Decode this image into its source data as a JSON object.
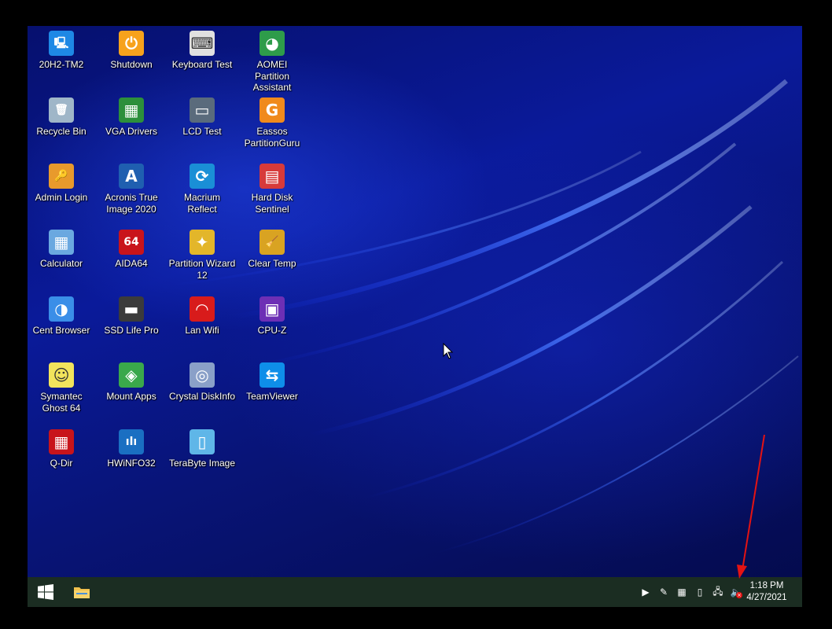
{
  "desktop": {
    "icons": [
      {
        "label": "20H2-TM2",
        "glyph": "🖳",
        "bg": "#1e88e5",
        "color": "#ffffff"
      },
      {
        "label": "Shutdown",
        "glyph": "⏻",
        "bg": "#f7a21c",
        "color": "#ffffff"
      },
      {
        "label": "Keyboard Test",
        "glyph": "⌨",
        "bg": "#e0e0e0",
        "color": "#333333"
      },
      {
        "label": "AOMEI Partition Assistant",
        "glyph": "◕",
        "bg": "#2e9c4a",
        "color": "#ffffff"
      },
      {
        "label": "Recycle Bin",
        "glyph": "🗑",
        "bg": "#9fb6c8",
        "color": "#ffffff"
      },
      {
        "label": "VGA Drivers",
        "glyph": "▦",
        "bg": "#2c8f3b",
        "color": "#ffffff"
      },
      {
        "label": "LCD Test",
        "glyph": "▭",
        "bg": "#5a6b7c",
        "color": "#ffffff"
      },
      {
        "label": "Eassos PartitionGuru",
        "glyph": "G",
        "bg": "#f08a1c",
        "color": "#ffffff"
      },
      {
        "label": "Admin Login",
        "glyph": "🔑",
        "bg": "#e89a2c",
        "color": "#ffffff"
      },
      {
        "label": "Acronis True Image 2020",
        "glyph": "A",
        "bg": "#1f5fb0",
        "color": "#ffffff"
      },
      {
        "label": "Macrium Reflect",
        "glyph": "⟳",
        "bg": "#1a8fd6",
        "color": "#ffffff"
      },
      {
        "label": "Hard Disk Sentinel",
        "glyph": "▤",
        "bg": "#d73a3a",
        "color": "#ffffff"
      },
      {
        "label": "Calculator",
        "glyph": "▦",
        "bg": "#6aa8e0",
        "color": "#ffffff"
      },
      {
        "label": "AIDA64",
        "glyph": "64",
        "bg": "#c9141b",
        "color": "#ffffff"
      },
      {
        "label": "Partition Wizard 12",
        "glyph": "✦",
        "bg": "#e3b62a",
        "color": "#ffffff"
      },
      {
        "label": "Clear Temp",
        "glyph": "🧹",
        "bg": "#d9a322",
        "color": "#ffffff"
      },
      {
        "label": "Cent Browser",
        "glyph": "◑",
        "bg": "#3a8ee8",
        "color": "#ffffff"
      },
      {
        "label": "SSD Life Pro",
        "glyph": "▬",
        "bg": "#3b3b3b",
        "color": "#ffffff"
      },
      {
        "label": "Lan Wifi",
        "glyph": "◠",
        "bg": "#d81b1b",
        "color": "#ffffff"
      },
      {
        "label": "CPU-Z",
        "glyph": "▣",
        "bg": "#6d2fb5",
        "color": "#ffffff"
      },
      {
        "label": "Symantec Ghost 64",
        "glyph": "☺",
        "bg": "#f2e45c",
        "color": "#333333"
      },
      {
        "label": "Mount Apps",
        "glyph": "◈",
        "bg": "#3aa84b",
        "color": "#ffffff"
      },
      {
        "label": "Crystal DiskInfo",
        "glyph": "◎",
        "bg": "#8aa0c8",
        "color": "#ffffff"
      },
      {
        "label": "TeamViewer",
        "glyph": "⇆",
        "bg": "#0e8ee9",
        "color": "#ffffff"
      },
      {
        "label": "Q-Dir",
        "glyph": "▦",
        "bg": "#c8141b",
        "color": "#ffffff"
      },
      {
        "label": "HWiNFO32",
        "glyph": "ılı",
        "bg": "#1a6fc2",
        "color": "#ffffff"
      },
      {
        "label": "TeraByte Image",
        "glyph": "▯",
        "bg": "#5fb6e8",
        "color": "#ffffff"
      }
    ]
  },
  "taskbar": {
    "start_glyph": "⊞",
    "explorer_glyph": "📁",
    "tray_icons": [
      {
        "name": "media-player-icon",
        "glyph": "▶"
      },
      {
        "name": "pen-tool-icon",
        "glyph": "✎"
      },
      {
        "name": "display-color-icon",
        "glyph": "▦"
      },
      {
        "name": "usb-drive-icon",
        "glyph": "▯"
      },
      {
        "name": "network-icon",
        "glyph": "🖧"
      },
      {
        "name": "volume-muted-icon",
        "glyph": "🔈"
      }
    ],
    "clock": {
      "time": "1:18 PM",
      "date": "4/27/2021"
    }
  }
}
